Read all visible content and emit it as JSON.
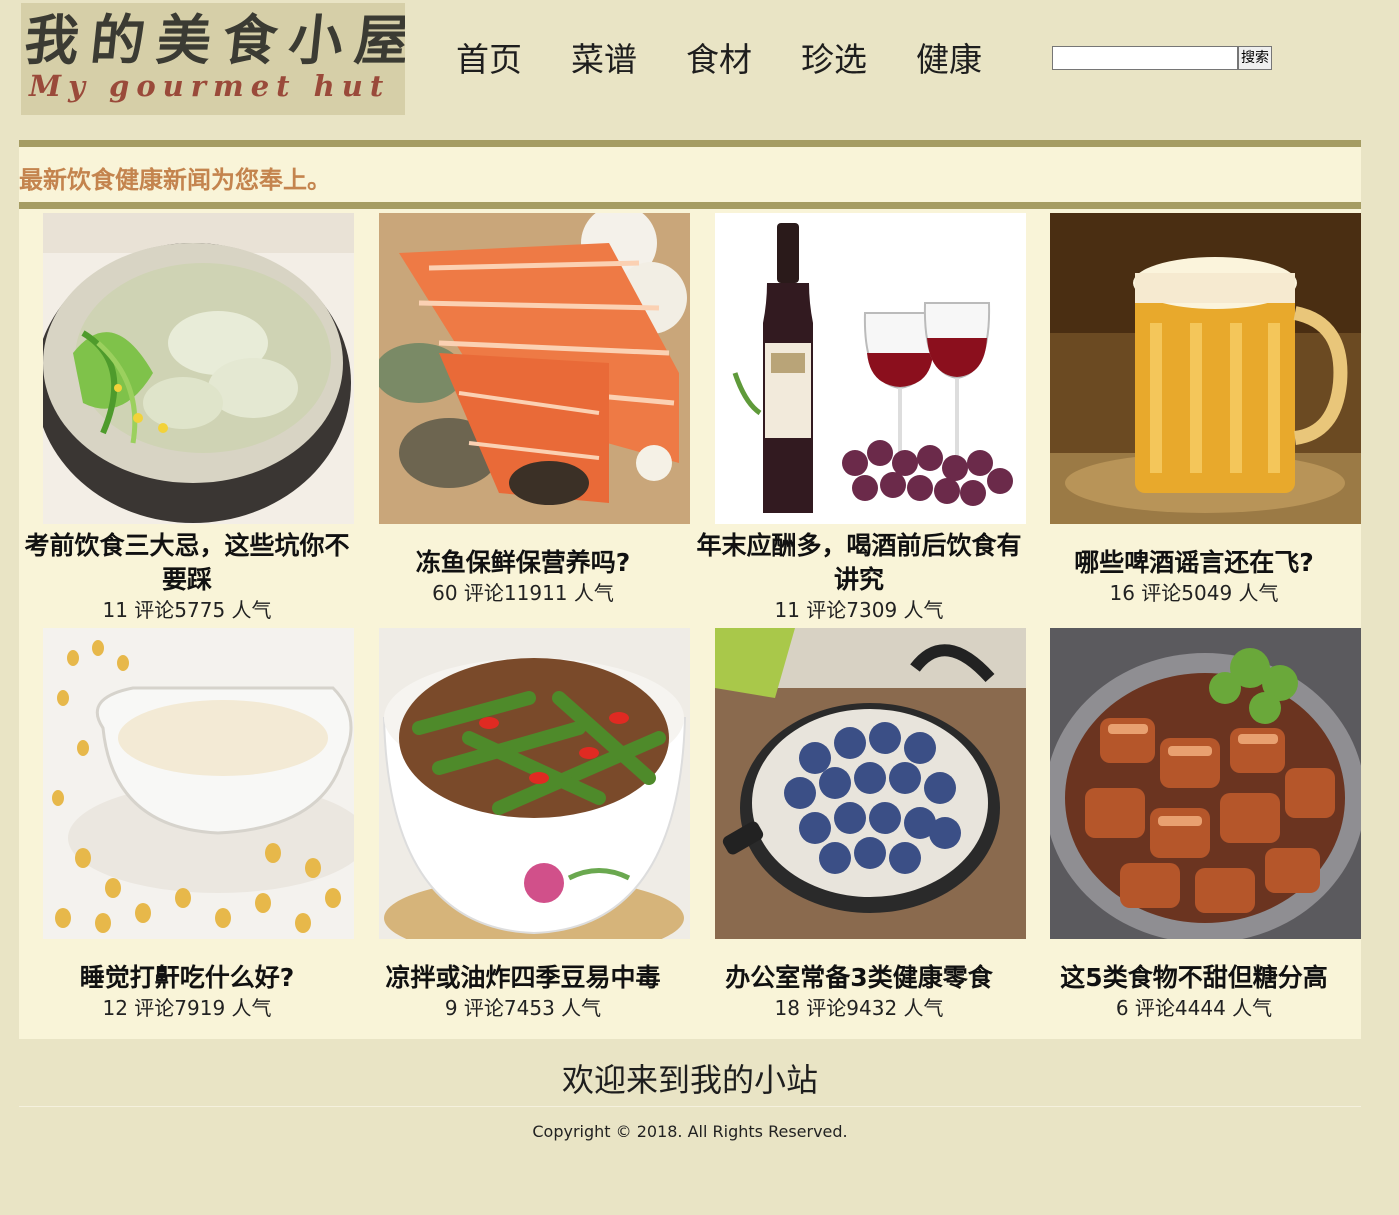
{
  "header": {
    "logo_cn": "我的美食小屋",
    "logo_en": "My gourmet hut"
  },
  "nav": {
    "items": [
      {
        "label": "首页"
      },
      {
        "label": "菜谱"
      },
      {
        "label": "食材"
      },
      {
        "label": "珍选"
      },
      {
        "label": "健康"
      }
    ]
  },
  "search": {
    "value": "",
    "button_label": "搜索"
  },
  "banner": {
    "text": "最新饮食健康新闻为您奉上。"
  },
  "cards": [
    {
      "title": "考前饮食三大忌，这些坑你不要踩",
      "meta": "11 评论5775 人气",
      "image": "dumpling-soup-image"
    },
    {
      "title": "冻鱼保鲜保营养吗?",
      "meta": "60 评论11911 人气",
      "image": "salmon-fillet-image"
    },
    {
      "title": "年末应酬多，喝酒前后饮食有讲究",
      "meta": "11 评论7309 人气",
      "image": "red-wine-image"
    },
    {
      "title": "哪些啤酒谣言还在飞?",
      "meta": "16 评论5049 人气",
      "image": "beer-mug-image"
    },
    {
      "title": "睡觉打鼾吃什么好?",
      "meta": "12 评论7919 人气",
      "image": "soy-milk-image"
    },
    {
      "title": "凉拌或油炸四季豆易中毒",
      "meta": "9 评论7453 人气",
      "image": "green-beans-image"
    },
    {
      "title": "办公室常备3类健康零食",
      "meta": "18 评论9432 人气",
      "image": "blueberries-image"
    },
    {
      "title": "这5类食物不甜但糖分高",
      "meta": "6 评论4444 人气",
      "image": "braised-pork-image"
    }
  ],
  "footer": {
    "welcome": "欢迎来到我的小站",
    "copyright": "Copyright © 2018. All Rights Reserved."
  },
  "colors": {
    "page_bg": "#e9e4c5",
    "content_bg": "#f9f4d8",
    "rule": "#a59c62",
    "banner_text": "#c4844e"
  }
}
